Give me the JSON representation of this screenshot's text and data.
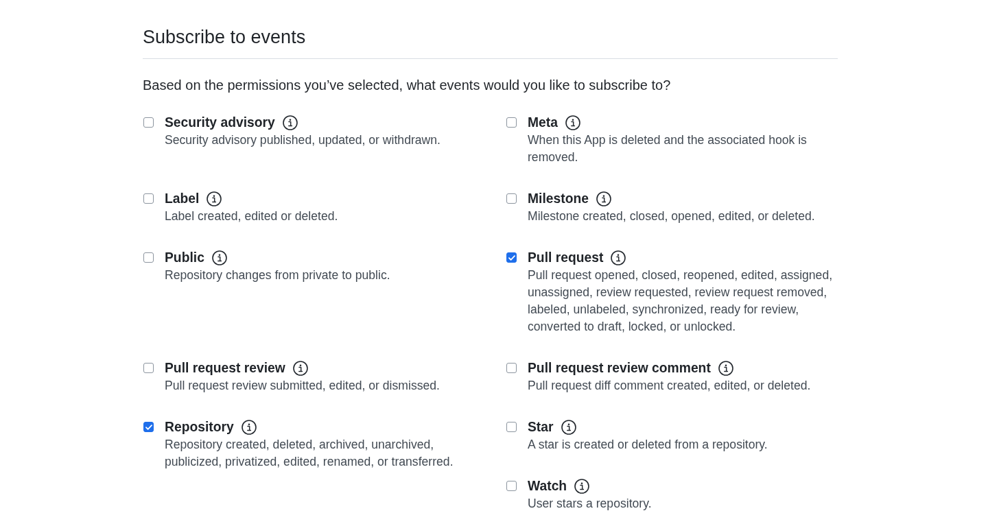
{
  "section": {
    "title": "Subscribe to events",
    "prompt": "Based on the permissions you’ve selected, what events would you like to subscribe to?"
  },
  "event_rows": [
    {
      "left": {
        "name": "Security advisory",
        "description": "Security advisory published, updated, or withdrawn.",
        "checked": false
      },
      "right": {
        "name": "Meta",
        "description": "When this App is deleted and the associated hook is removed.",
        "checked": false
      }
    },
    {
      "left": {
        "name": "Label",
        "description": "Label created, edited or deleted.",
        "checked": false
      },
      "right": {
        "name": "Milestone",
        "description": "Milestone created, closed, opened, edited, or deleted.",
        "checked": false
      }
    },
    {
      "left": {
        "name": "Public",
        "description": "Repository changes from private to public.",
        "checked": false
      },
      "right": {
        "name": "Pull request",
        "description": "Pull request opened, closed, reopened, edited, assigned, unassigned, review requested, review request removed, labeled, unlabeled, synchronized, ready for review, converted to draft, locked, or unlocked.",
        "checked": true
      }
    },
    {
      "left": {
        "name": "Pull request review",
        "description": "Pull request review submitted, edited, or dismissed.",
        "checked": false
      },
      "right": {
        "name": "Pull request review comment",
        "description": "Pull request diff comment created, edited, or deleted.",
        "checked": false
      }
    },
    {
      "left": {
        "name": "Repository",
        "description": "Repository created, deleted, archived, unarchived, publicized, privatized, edited, renamed, or transferred.",
        "checked": true
      },
      "right": {
        "name": "Star",
        "description": "A star is created or deleted from a repository.",
        "checked": false
      }
    },
    {
      "right": {
        "name": "Watch",
        "description": "User stars a repository.",
        "checked": false
      }
    }
  ]
}
